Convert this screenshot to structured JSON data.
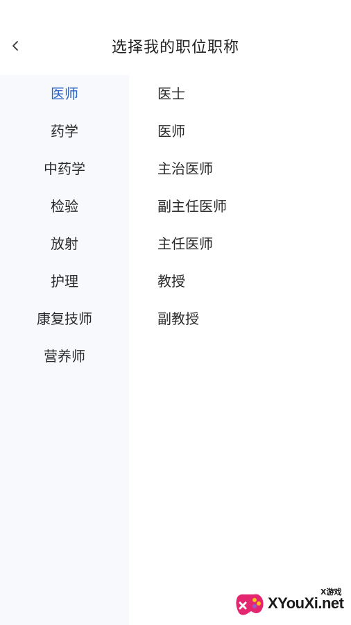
{
  "header": {
    "title": "选择我的职位职称",
    "back_icon": "chevron-left-icon"
  },
  "sidebar": {
    "items": [
      {
        "label": "医师",
        "active": true
      },
      {
        "label": "药学",
        "active": false
      },
      {
        "label": "中药学",
        "active": false
      },
      {
        "label": "检验",
        "active": false
      },
      {
        "label": "放射",
        "active": false
      },
      {
        "label": "护理",
        "active": false
      },
      {
        "label": "康复技师",
        "active": false
      },
      {
        "label": "营养师",
        "active": false
      }
    ]
  },
  "positions": {
    "items": [
      {
        "label": "医士"
      },
      {
        "label": "医师"
      },
      {
        "label": "主治医师"
      },
      {
        "label": "副主任医师"
      },
      {
        "label": "主任医师"
      },
      {
        "label": "教授"
      },
      {
        "label": "副教授"
      }
    ]
  },
  "watermark": {
    "brand": "XYouXi.net",
    "sub": "X游戏"
  },
  "colors": {
    "accent": "#2b63c4",
    "sidebar_bg": "#f7f9fc",
    "text": "#2a2a2a"
  }
}
